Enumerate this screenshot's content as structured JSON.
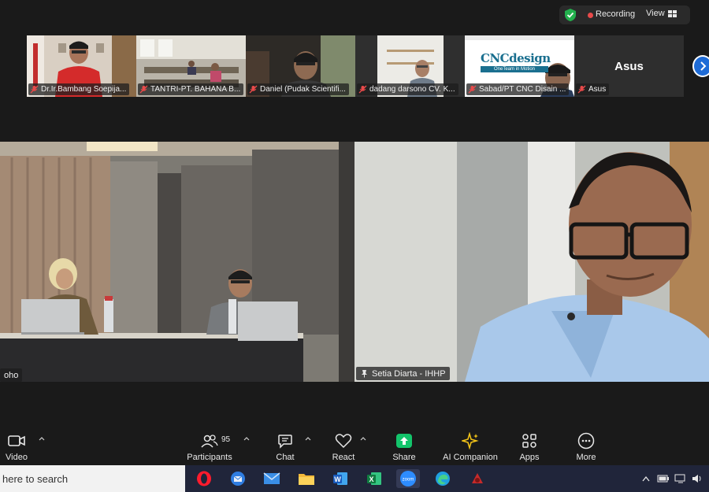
{
  "status": {
    "recording_label": "Recording",
    "view_label": "View"
  },
  "thumbnails": [
    {
      "name": "Dr.Ir.Bambang Soepija..."
    },
    {
      "name": "TANTRI-PT. BAHANA B..."
    },
    {
      "name": "Daniel (Pudak Scientifi..."
    },
    {
      "name": "dadang darsono CV. K..."
    },
    {
      "name": "Sabad/PT CNC Disain ..."
    },
    {
      "name": "Asus",
      "tile_label": "Asus"
    }
  ],
  "cnc_logo": {
    "brand": "CNCdesign",
    "tagline": "OneTeam in Motion"
  },
  "main_videos": {
    "left_name": "oho",
    "right_name": "Setia Diarta - IHHP"
  },
  "toolbar": {
    "video": "Video",
    "participants": "Participants",
    "participants_count": "95",
    "chat": "Chat",
    "react": "React",
    "share": "Share",
    "ai_companion": "AI Companion",
    "apps": "Apps",
    "more": "More"
  },
  "taskbar": {
    "search_placeholder": "here to search"
  },
  "colors": {
    "recording": "#e84a4a",
    "share": "#13c46b",
    "accent": "#1e6bd6",
    "ai": "#f5c518"
  }
}
